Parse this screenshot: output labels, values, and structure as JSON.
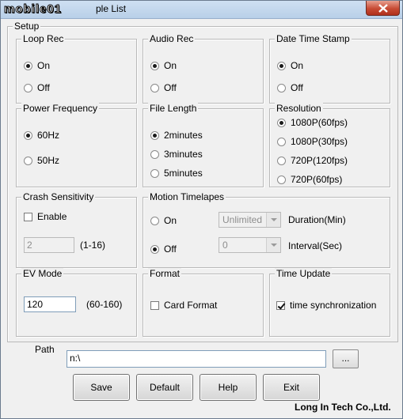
{
  "window": {
    "logo_text": "mobile01",
    "title_text": "ple List"
  },
  "setup": {
    "label": "Setup",
    "loop_rec": {
      "label": "Loop Rec",
      "options": [
        "On",
        "Off"
      ],
      "selected": "On"
    },
    "audio_rec": {
      "label": "Audio Rec",
      "options": [
        "On",
        "Off"
      ],
      "selected": "On"
    },
    "date_time_stamp": {
      "label": "Date Time Stamp",
      "options": [
        "On",
        "Off"
      ],
      "selected": "On"
    },
    "power_frequency": {
      "label": "Power Frequency",
      "options": [
        "60Hz",
        "50Hz"
      ],
      "selected": "60Hz"
    },
    "file_length": {
      "label": "File Length",
      "options": [
        "2minutes",
        "3minutes",
        "5minutes"
      ],
      "selected": "2minutes"
    },
    "resolution": {
      "label": "Resolution",
      "options": [
        "1080P(60fps)",
        "1080P(30fps)",
        "720P(120fps)",
        "720P(60fps)"
      ],
      "selected": "1080P(60fps)"
    },
    "crash_sensitivity": {
      "label": "Crash Sensitivity",
      "enable_label": "Enable",
      "enabled": false,
      "value": "2",
      "range": "(1-16)"
    },
    "motion_timelapes": {
      "label": "Motion Timelapes",
      "options": [
        "On",
        "Off"
      ],
      "selected": "Off",
      "duration_value": "Unlimited",
      "duration_label": "Duration(Min)",
      "interval_value": "0",
      "interval_label": "Interval(Sec)"
    },
    "ev_mode": {
      "label": "EV Mode",
      "value": "120",
      "range": "(60-160)"
    },
    "format": {
      "label": "Format",
      "card_format_label": "Card Format",
      "checked": false
    },
    "time_update": {
      "label": "Time Update",
      "sync_label": "time synchronization",
      "checked": true
    }
  },
  "path": {
    "label": "Path",
    "value": "n:\\",
    "browse_label": "..."
  },
  "buttons": {
    "save": "Save",
    "default": "Default",
    "help": "Help",
    "exit": "Exit"
  },
  "footer": {
    "company": "Long In Tech Co.,Ltd."
  }
}
